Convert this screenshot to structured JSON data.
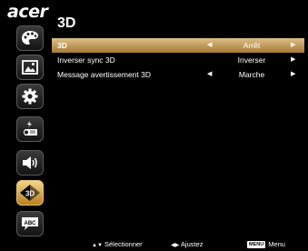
{
  "brand": "acer",
  "page_title": "3D",
  "sidebar": {
    "icons": [
      {
        "name": "color-palette-icon"
      },
      {
        "name": "image-icon"
      },
      {
        "name": "settings-gear-icon"
      },
      {
        "name": "projector-management-icon"
      },
      {
        "name": "audio-volume-icon"
      },
      {
        "name": "3d-icon",
        "label": "3D",
        "active": true
      },
      {
        "name": "language-abc-icon",
        "label": "ABC"
      }
    ]
  },
  "menu": {
    "rows": [
      {
        "label": "3D",
        "value": "Arrêt",
        "left_arrow": "◀",
        "right_arrow": "▶",
        "selected": true
      },
      {
        "label": "Inverser sync 3D",
        "value": "Inverser",
        "left_arrow": "",
        "right_arrow": "▶"
      },
      {
        "label": "Message avertissement 3D",
        "value": "Marche",
        "left_arrow": "◀",
        "right_arrow": "▶"
      }
    ]
  },
  "footer": {
    "select_arrows": "▲▼",
    "select_label": "Sélectionner",
    "adjust_arrows": "◀▶",
    "adjust_label": "Ajustez",
    "menu_key": "MENU",
    "menu_label": "Menu"
  }
}
